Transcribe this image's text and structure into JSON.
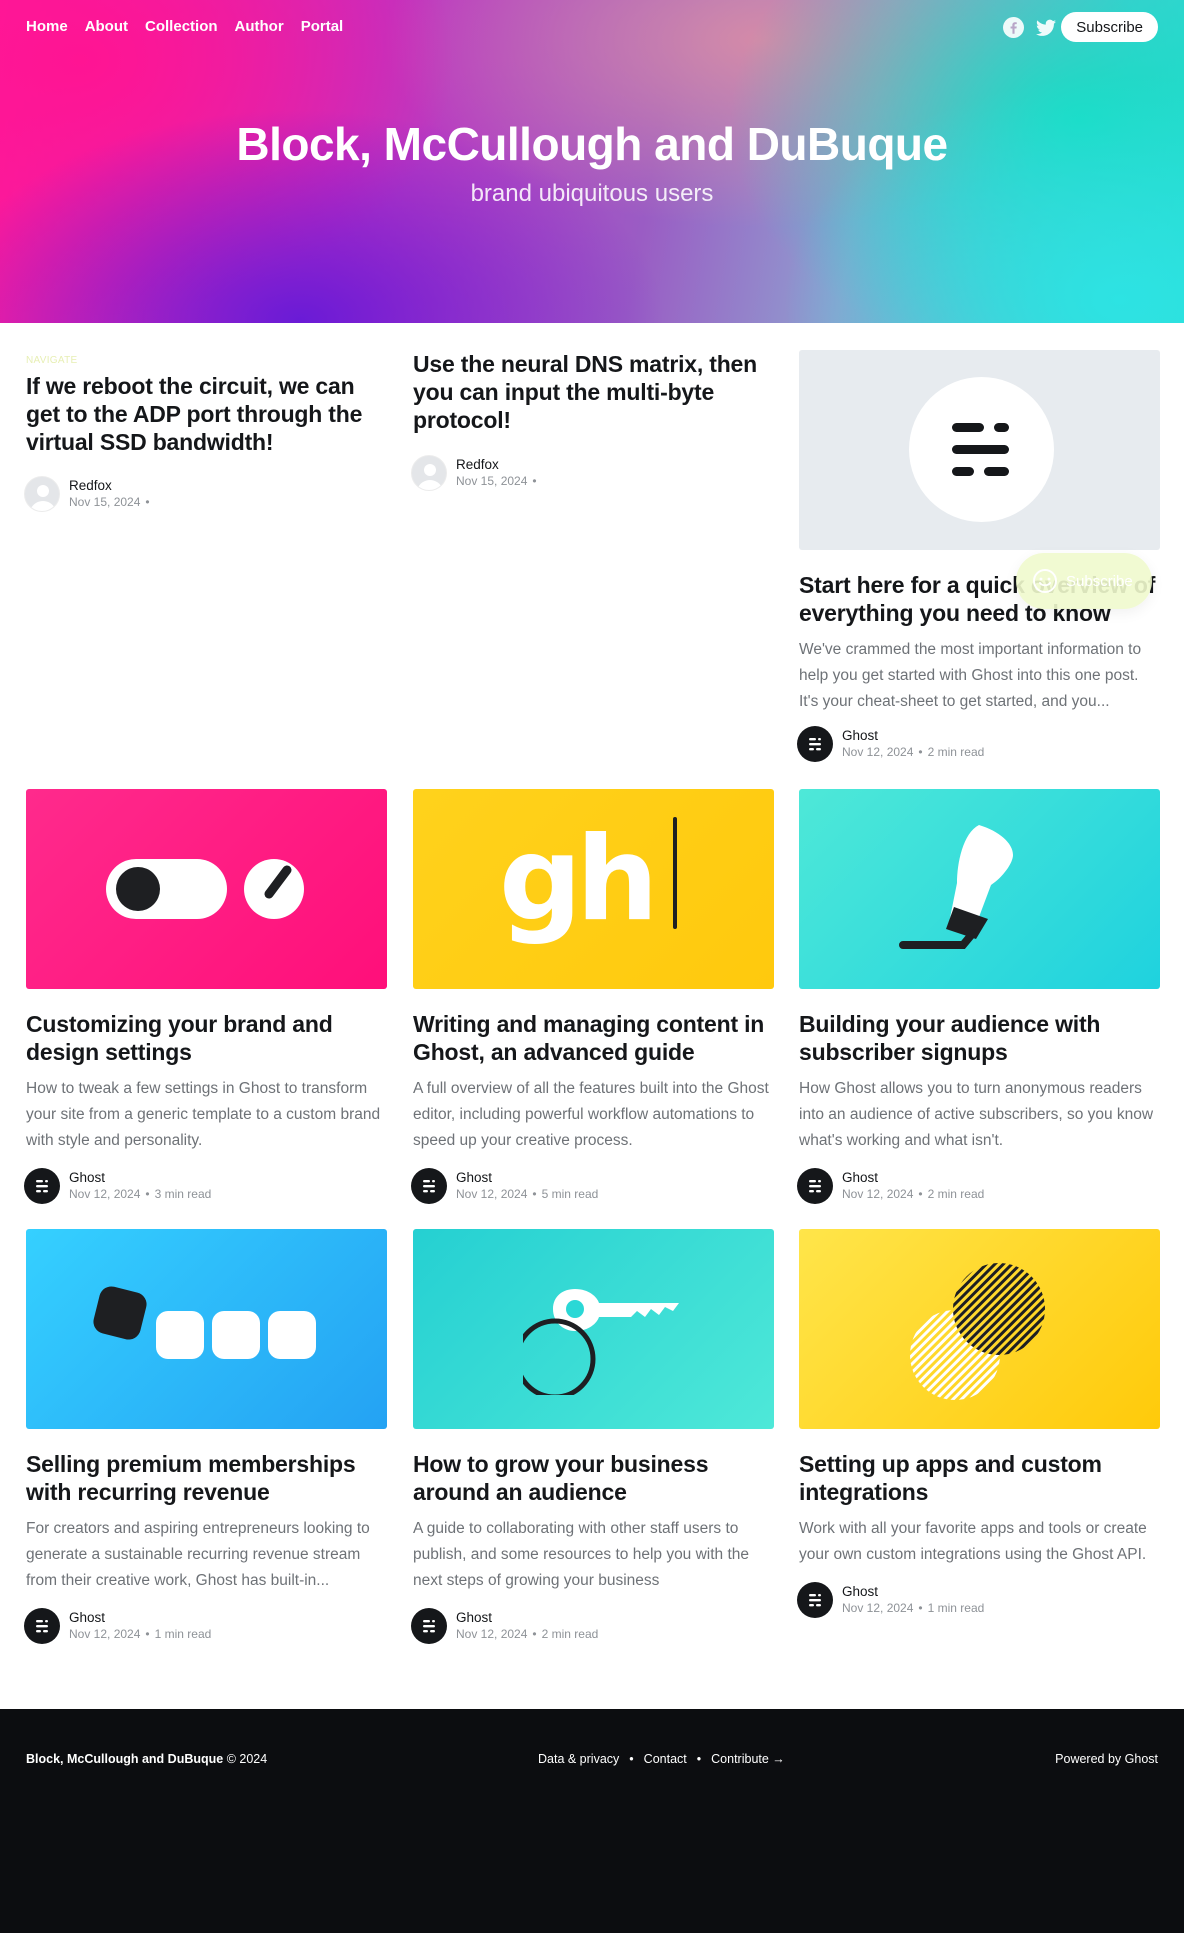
{
  "nav": {
    "items": [
      "Home",
      "About",
      "Collection",
      "Author",
      "Portal"
    ],
    "subscribe": "Subscribe"
  },
  "hero": {
    "title": "Block, McCullough and DuBuque",
    "description": "brand ubiquitous users"
  },
  "posts": [
    {
      "tag": "NAVIGATE",
      "title": "If we reboot the circuit, we can get to the ADP port through the virtual SSD bandwidth!",
      "author": "Redfox",
      "date": "Nov 15, 2024",
      "read": ""
    },
    {
      "title": "Use the neural DNS matrix, then you can input the multi-byte protocol!",
      "author": "Redfox",
      "date": "Nov 15, 2024",
      "read": ""
    },
    {
      "title": "Start here for a quick overview of everything you need to know",
      "excerpt": "We've crammed the most important information to help you get started with Ghost into this one post. It's your cheat-sheet to get started, and you...",
      "author": "Ghost",
      "date": "Nov 12, 2024",
      "read": "2 min read"
    },
    {
      "title": "Customizing your brand and design settings",
      "excerpt": "How to tweak a few settings in Ghost to transform your site from a generic template to a custom brand with style and personality.",
      "author": "Ghost",
      "date": "Nov 12, 2024",
      "read": "3 min read"
    },
    {
      "title": "Writing and managing content in Ghost, an advanced guide",
      "excerpt": "A full overview of all the features built into the Ghost editor, including powerful workflow automations to speed up your creative process.",
      "author": "Ghost",
      "date": "Nov 12, 2024",
      "read": "5 min read"
    },
    {
      "title": "Building your audience with subscriber signups",
      "excerpt": "How Ghost allows you to turn anonymous readers into an audience of active subscribers, so you know what's working and what isn't.",
      "author": "Ghost",
      "date": "Nov 12, 2024",
      "read": "2 min read"
    },
    {
      "title": "Selling premium memberships with recurring revenue",
      "excerpt": "For creators and aspiring entrepreneurs looking to generate a sustainable recurring revenue stream from their creative work, Ghost has built-in...",
      "author": "Ghost",
      "date": "Nov 12, 2024",
      "read": "1 min read"
    },
    {
      "title": "How to grow your business around an audience",
      "excerpt": "A guide to collaborating with other staff users to publish, and some resources to help you with the next steps of growing your business",
      "author": "Ghost",
      "date": "Nov 12, 2024",
      "read": "2 min read"
    },
    {
      "title": "Setting up apps and custom integrations",
      "excerpt": "Work with all your favorite apps and tools or create your own custom integrations using the Ghost API.",
      "author": "Ghost",
      "date": "Nov 12, 2024",
      "read": "1 min read"
    }
  ],
  "thumb_glyph": "gh",
  "portal": {
    "label": "Subscribe"
  },
  "footer": {
    "site": "Block, McCullough and DuBuque",
    "copyright": "© 2024",
    "links": [
      "Data & privacy",
      "Contact",
      "Contribute →"
    ],
    "sep": "•",
    "powered": "Powered by Ghost"
  },
  "colors": {
    "brand_pink": "#ff1a9c",
    "brand_teal": "#2ddcd6",
    "text": "#15171a",
    "muted": "#6e7277",
    "footer_bg": "#0c0d10",
    "accent_yellow": "#ffd60a"
  },
  "icons": [
    "facebook-icon",
    "twitter-icon",
    "ghost-logo-icon",
    "toggle-icon",
    "pen-icon",
    "members-icon",
    "key-icon",
    "integrations-icon",
    "portal-smile-icon"
  ]
}
